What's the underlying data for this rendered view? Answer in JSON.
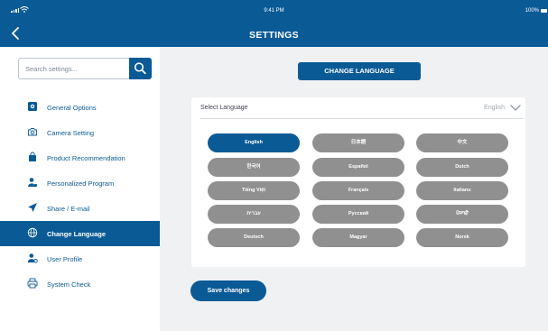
{
  "status": {
    "time": "9:41 PM",
    "battery": "100%"
  },
  "header": {
    "title": "SETTINGS"
  },
  "search": {
    "placeholder": "Search settings..."
  },
  "nav": [
    {
      "label": "General Options",
      "icon": "gear-icon"
    },
    {
      "label": "Camera Setting",
      "icon": "camera-icon"
    },
    {
      "label": "Product Recommendation",
      "icon": "bag-icon"
    },
    {
      "label": "Personalized Program",
      "icon": "user-gear-icon"
    },
    {
      "label": "Share / E-mail",
      "icon": "send-icon"
    },
    {
      "label": "Change Language",
      "icon": "globe-icon",
      "active": true
    },
    {
      "label": "User Profile",
      "icon": "user-settings-icon"
    },
    {
      "label": "System Check",
      "icon": "printer-icon"
    }
  ],
  "main": {
    "change_language_label": "CHANGE LANGUAGE",
    "select": {
      "label": "Select Language",
      "value": "English"
    },
    "languages": [
      "English",
      "日本語",
      "中文",
      "한국어",
      "Español",
      "Dutch",
      "Tiếng Việt",
      "Français",
      "Italiano",
      "עברית",
      "Pусский",
      "ਪੰਜਾਬੀ",
      "Deutsch",
      "Magyar",
      "Norsk"
    ],
    "selected_language": "English",
    "save_label": "Save changes"
  },
  "colors": {
    "primary": "#0a5a96",
    "pill_inactive": "#909090",
    "background": "#f0f1f3"
  }
}
